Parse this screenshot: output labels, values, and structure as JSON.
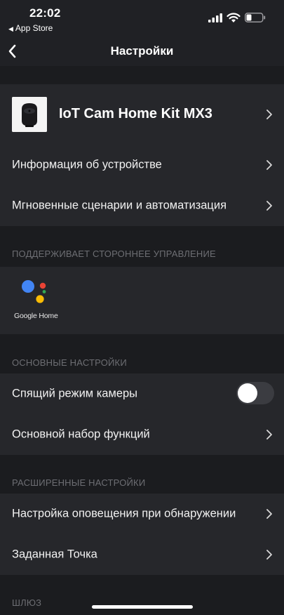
{
  "status_bar": {
    "time": "22:02",
    "back_app": "App Store",
    "back_icon": "triangle-left-icon"
  },
  "nav": {
    "title": "Настройки",
    "back_icon": "chevron-left-icon"
  },
  "device": {
    "name": "IoT Cam Home Kit MX3"
  },
  "device_rows": [
    {
      "label": "Информация об устройстве"
    },
    {
      "label": "Мгновенные сценарии и автоматизация"
    }
  ],
  "third_party": {
    "title": "ПОДДЕРЖИВАЕТ СТОРОННЕЕ УПРАВЛЕНИЕ",
    "google_home_label": "Google Home",
    "colors": {
      "blue": "#4285F4",
      "red": "#EA4335",
      "yellow": "#FBBC05",
      "green": "#34A853"
    }
  },
  "basic": {
    "title": "ОСНОВНЫЕ НАСТРОЙКИ",
    "sleep_mode": {
      "label": "Спящий режим камеры",
      "enabled": false
    },
    "features": {
      "label": "Основной набор функций"
    }
  },
  "advanced": {
    "title": "РАСШИРЕННЫЕ НАСТРОЙКИ",
    "rows": [
      {
        "label": "Настройка оповещения при обнаружении"
      },
      {
        "label": "Заданная Точка"
      }
    ]
  },
  "gateway": {
    "title": "ШЛЮЗ"
  }
}
